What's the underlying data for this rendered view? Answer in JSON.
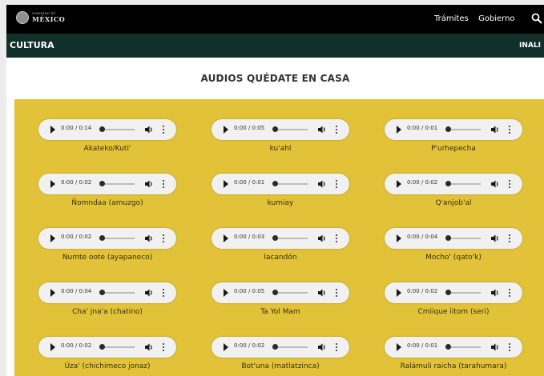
{
  "header": {
    "logo_small": "GOBIERNO DE",
    "logo_big": "MÉXICO",
    "nav": [
      "Trámites",
      "Gobierno"
    ]
  },
  "subheader": {
    "brand": "CULTURA",
    "nav_item": "INALI"
  },
  "page": {
    "title": "AUDIOS QUÉDATE EN CASA"
  },
  "audio_grid": [
    {
      "time": "0:00 / 0:14",
      "label": "Akateko/Kuti'"
    },
    {
      "time": "0:00 / 0:05",
      "label": "ku'ahl"
    },
    {
      "time": "0:00 / 0:01",
      "label": "P'urhepecha"
    },
    {
      "time": "0:00 / 0:02",
      "label": "Ñomndaa (amuzgo)"
    },
    {
      "time": "0:00 / 0:01",
      "label": "kumiay"
    },
    {
      "time": "0:00 / 0:02",
      "label": "Q'anjob'al"
    },
    {
      "time": "0:00 / 0:02",
      "label": "Numte oote (ayapaneco)"
    },
    {
      "time": "0:00 / 0:03",
      "label": "lacandón"
    },
    {
      "time": "0:00 / 0:04",
      "label": "Mocho' (qato'k)"
    },
    {
      "time": "0:00 / 0:04",
      "label": "Cha' jna'a (chatino)"
    },
    {
      "time": "0:00 / 0:05",
      "label": "Ta Yol Mam"
    },
    {
      "time": "0:00 / 0:02",
      "label": "Cmiique iitom (seri)"
    },
    {
      "time": "0:00 / 0:02",
      "label": "Úza' (chichimeco jonaz)"
    },
    {
      "time": "0:00 / 0:02",
      "label": "Bot'una (matlatzinca)"
    },
    {
      "time": "0:00 / 0:01",
      "label": "Ralámuli raicha (tarahumara)"
    }
  ],
  "colors": {
    "topbar": "#000000",
    "subbar": "#11302a",
    "panel": "#e2c238"
  },
  "icons": {
    "search": "search-icon",
    "play": "play-icon",
    "volume": "volume-icon",
    "more": "more-options-icon"
  }
}
